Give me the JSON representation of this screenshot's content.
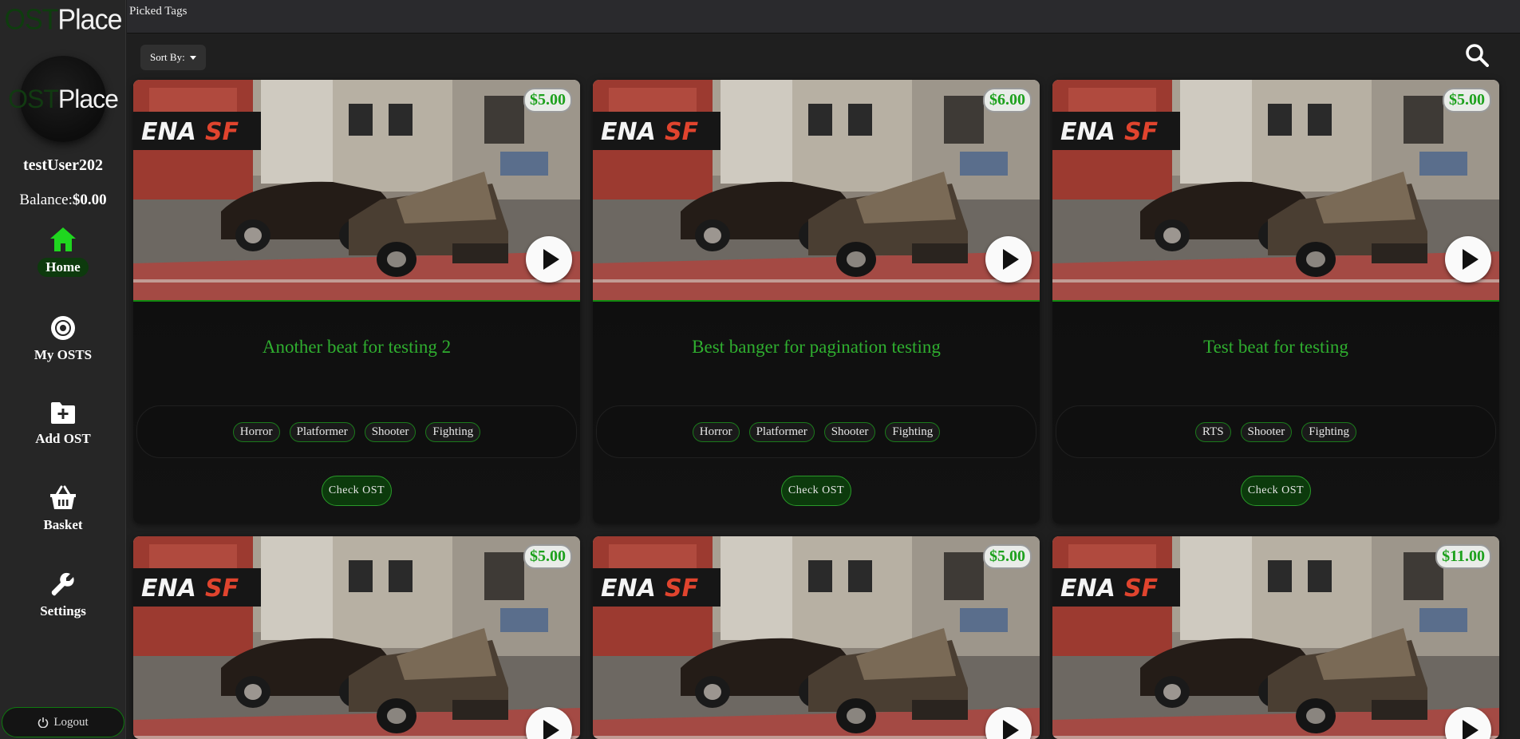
{
  "sidebar": {
    "brand_part1": "OST",
    "brand_part2": "Place",
    "avatar_part1": "OST",
    "avatar_part2": "Place",
    "username": "testUser202",
    "balance_label": "Balance:",
    "balance_value": "$0.00",
    "nav": [
      {
        "label": "Home",
        "icon": "home-icon",
        "active": true
      },
      {
        "label": "My OSTS",
        "icon": "disc-icon"
      },
      {
        "label": "Add OST",
        "icon": "folder-plus-icon"
      },
      {
        "label": "Basket",
        "icon": "basket-icon"
      },
      {
        "label": "Settings",
        "icon": "wrench-icon"
      }
    ],
    "logout_label": "Logout"
  },
  "header": {
    "picked_tags_label": "Picked Tags",
    "sort_label": "Sort By:"
  },
  "colors": {
    "accent": "#2fae2f",
    "active_icon": "#1fd61f",
    "background": "#1f1f1f"
  },
  "cards": [
    {
      "price": "$5.00",
      "title": "Another beat for testing 2",
      "tags": [
        "Horror",
        "Platformer",
        "Shooter",
        "Fighting"
      ],
      "button": "Check OST"
    },
    {
      "price": "$6.00",
      "title": "Best banger for pagination testing",
      "tags": [
        "Horror",
        "Platformer",
        "Shooter",
        "Fighting"
      ],
      "button": "Check OST"
    },
    {
      "price": "$5.00",
      "title": "Test beat for testing",
      "tags": [
        "RTS",
        "Shooter",
        "Fighting"
      ],
      "button": "Check OST"
    },
    {
      "price": "$5.00"
    },
    {
      "price": "$5.00"
    },
    {
      "price": "$11.00"
    }
  ]
}
